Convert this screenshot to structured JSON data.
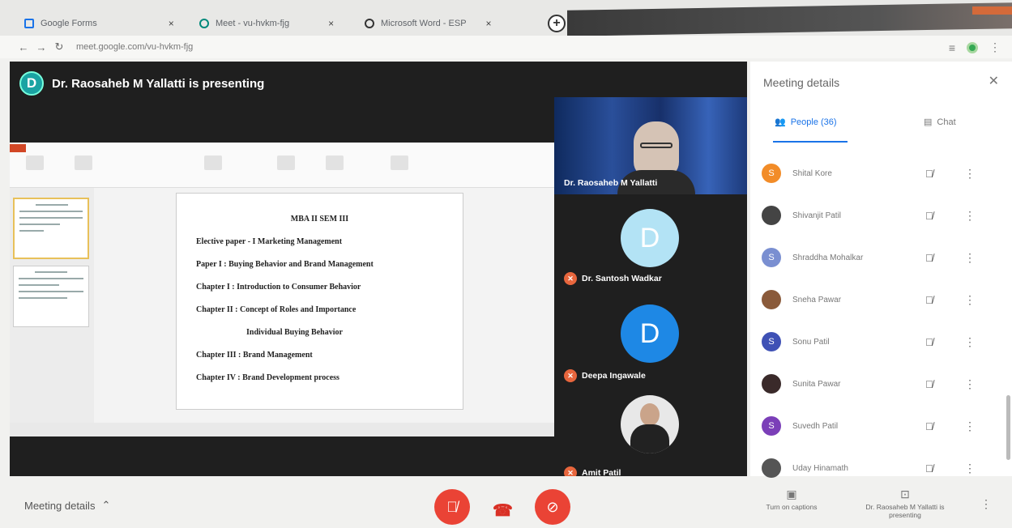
{
  "browser": {
    "tabs": [
      {
        "title": "Google Forms"
      },
      {
        "title": "Meet - vu-hvkm-fjg"
      },
      {
        "title": "Microsoft Word - ESP"
      }
    ],
    "url": "meet.google.com/vu-hvkm-fjg"
  },
  "meeting": {
    "presenter_initial": "D",
    "presenting_text": "Dr. Raosaheb M Yallatti is presenting",
    "slide": {
      "title": "MBA II    SEM III",
      "lines": [
        "Elective paper - I Marketing  Management",
        "Paper I : Buying Behavior and Brand Management",
        "Chapter I : Introduction to Consumer Behavior",
        "Chapter II : Concept of Roles and Importance",
        "Individual Buying Behavior",
        "Chapter III : Brand Management",
        "Chapter IV : Brand Development process"
      ]
    },
    "participants_tiles": [
      {
        "name": "Dr. Raosaheb M Yallatti",
        "type": "video"
      },
      {
        "name": "Dr. Santosh Wadkar",
        "initial": "D",
        "color": "#b3e3f5"
      },
      {
        "name": "Deepa Ingawale",
        "initial": "D",
        "color": "#1e88e5"
      },
      {
        "name": "Amit Patil",
        "type": "photo"
      }
    ]
  },
  "controls": {
    "meeting_details": "Meeting details",
    "captions": "Turn on captions",
    "presenting_status": "Dr. Raosaheb M Yallatti is presenting"
  },
  "panel": {
    "title": "Meeting details",
    "tab_people": "People (36)",
    "tab_chat": "Chat",
    "people": [
      {
        "name": "Shital Kore",
        "initial": "S",
        "color": "#f28c28"
      },
      {
        "name": "Shivanjit Patil",
        "initial": "",
        "color": "#444444"
      },
      {
        "name": "Shraddha Mohalkar",
        "initial": "S",
        "color": "#7a8fd1"
      },
      {
        "name": "Sneha Pawar",
        "initial": "",
        "color": "#8a5a3a"
      },
      {
        "name": "Sonu Patil",
        "initial": "S",
        "color": "#3f51b5"
      },
      {
        "name": "Sunita Pawar",
        "initial": "",
        "color": "#3a2a2a"
      },
      {
        "name": "Suvedh Patil",
        "initial": "S",
        "color": "#7b3fb8"
      },
      {
        "name": "Uday Hinamath",
        "initial": "",
        "color": "#555555"
      }
    ]
  }
}
